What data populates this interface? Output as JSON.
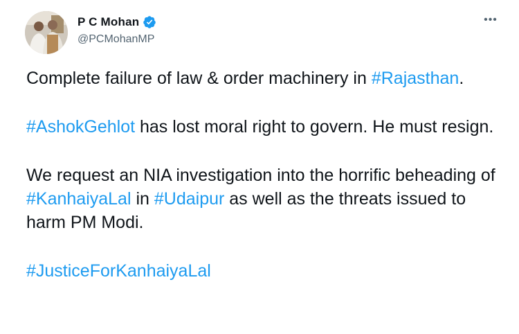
{
  "author": {
    "display_name": "P C Mohan",
    "handle": "@PCMohanMP",
    "verified": true,
    "avatar": "avatar-photo"
  },
  "menu": {
    "more_icon": "•••"
  },
  "tweet": {
    "p1": {
      "text1": "Complete failure of law & order machinery in ",
      "hashtag1": "#Rajasthan",
      "text2": "."
    },
    "p2": {
      "hashtag1": "#AshokGehlot",
      "text1": " has lost moral right to govern. He must resign."
    },
    "p3": {
      "text1": "We request an NIA investigation into the horrific beheading of ",
      "hashtag1": "#KanhaiyaLal",
      "text2": " in ",
      "hashtag2": "#Udaipur",
      "text3": " as well as the threats issued to harm PM Modi."
    },
    "p4": {
      "hashtag1": "#JusticeForKanhaiyaLal"
    }
  },
  "colors": {
    "hashtag": "#1d9bf0",
    "text": "#0f1419",
    "secondary": "#536471",
    "verified": "#1d9bf0"
  }
}
